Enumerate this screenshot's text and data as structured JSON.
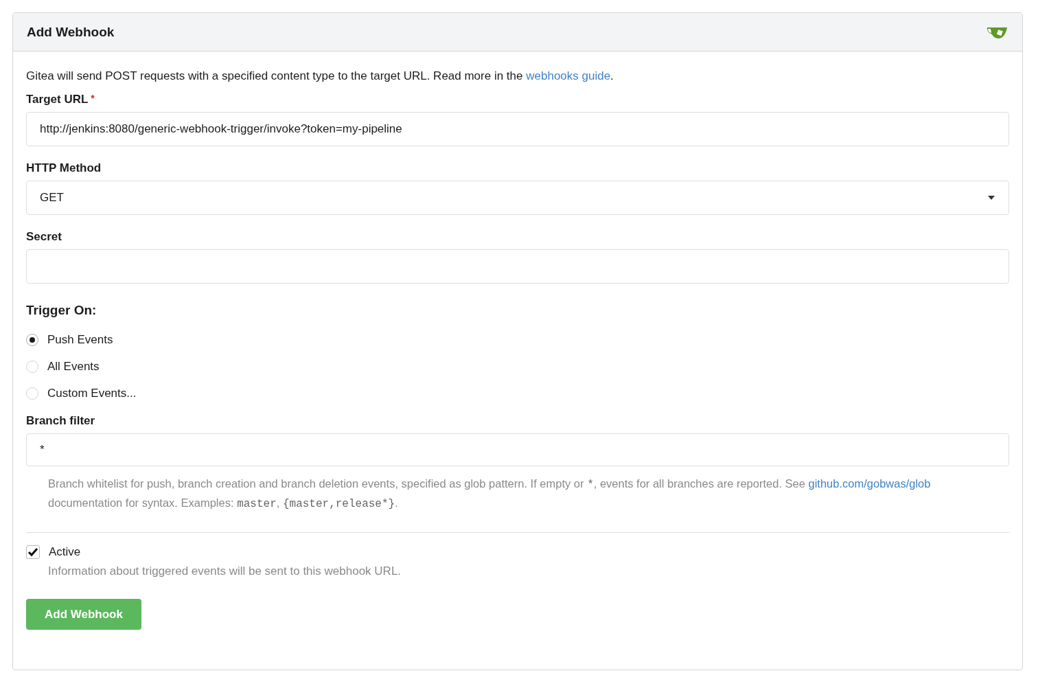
{
  "header": {
    "title": "Add Webhook"
  },
  "intro": [
    {
      "kind": "text",
      "text": "Gitea will send POST requests with a specified content type to the target URL. Read more in the "
    },
    {
      "kind": "link",
      "text": "webhooks guide"
    },
    {
      "kind": "text",
      "text": "."
    }
  ],
  "fields": [
    {
      "kind": "input",
      "label": "Target URL",
      "required_mark": "*",
      "value": "http://jenkins:8080/generic-webhook-trigger/invoke?token=my-pipeline"
    },
    {
      "kind": "select",
      "label": "HTTP Method",
      "value": "GET"
    },
    {
      "kind": "input",
      "label": "Secret"
    }
  ],
  "trigger": {
    "label": "Trigger On:",
    "options": [
      {
        "label": "Push Events",
        "selected": true
      },
      {
        "label": "All Events",
        "selected": false
      },
      {
        "label": "Custom Events...",
        "selected": false
      }
    ]
  },
  "branch_filter": {
    "label": "Branch filter",
    "value": "*",
    "help": [
      {
        "kind": "text",
        "text": "Branch whitelist for push, branch creation and branch deletion events, specified as glob pattern. If empty or "
      },
      {
        "kind": "code",
        "text": "*"
      },
      {
        "kind": "text",
        "text": ", events for all branches are reported. See "
      },
      {
        "kind": "link",
        "text": "github.com/gobwas/glob"
      },
      {
        "kind": "text",
        "text": " documentation for syntax. Examples: "
      },
      {
        "kind": "code",
        "text": "master"
      },
      {
        "kind": "text",
        "text": ", "
      },
      {
        "kind": "code",
        "text": "{master,release*}"
      },
      {
        "kind": "text",
        "text": "."
      }
    ]
  },
  "active": {
    "label": "Active",
    "checked": true,
    "help": "Information about triggered events will be sent to this webhook URL."
  },
  "submit": "Add Webhook"
}
